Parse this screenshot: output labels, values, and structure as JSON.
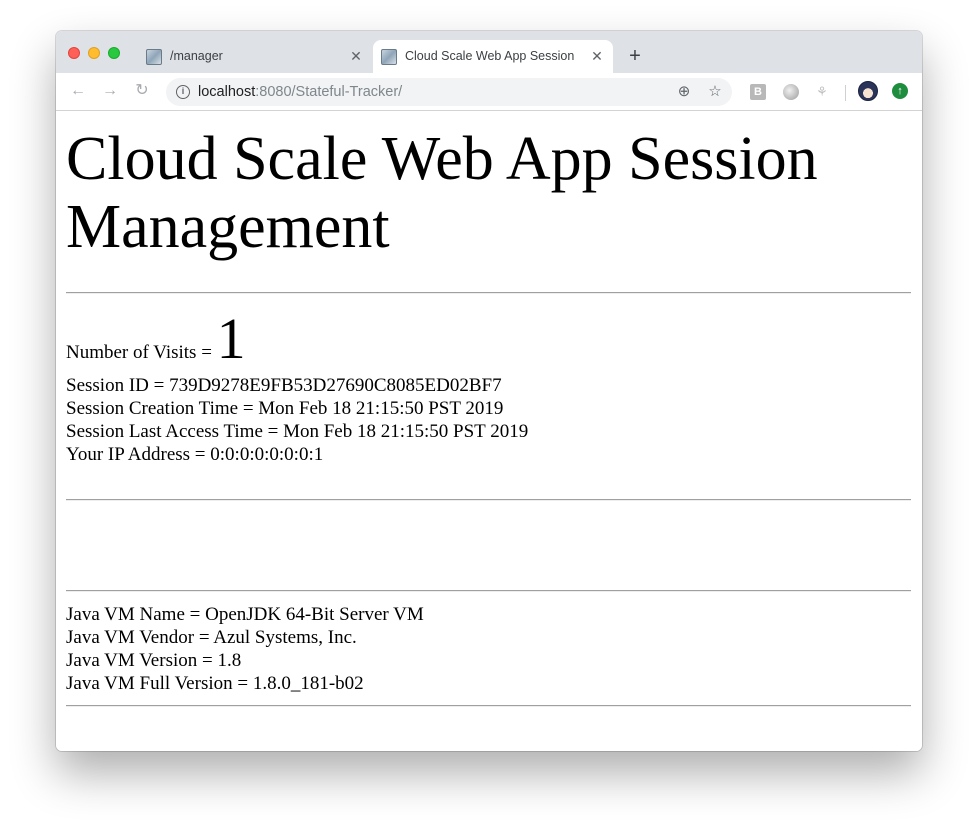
{
  "browser": {
    "tabs": [
      {
        "title": "/manager",
        "close": "✕",
        "active": false
      },
      {
        "title": "Cloud Scale Web App Session Management",
        "close": "✕",
        "active": true
      }
    ],
    "new_tab": "+",
    "url_host": "localhost",
    "url_rest": ":8080/Stateful-Tracker/",
    "nav": {
      "back": "←",
      "forward": "→",
      "reload": "↻"
    },
    "omnibox_icons": {
      "info": "i",
      "zoom": "⊕",
      "bookmark": "☆"
    },
    "extensions": {
      "b_label": "B",
      "update": "↑"
    }
  },
  "page": {
    "heading": "Cloud Scale Web App Session Management",
    "visits_label": "Number of Visits = ",
    "visits_count": "1",
    "session_id": "Session ID = 739D9278E9FB53D27690C8085ED02BF7",
    "creation_time": "Session Creation Time = Mon Feb 18 21:15:50 PST 2019",
    "last_access_time": "Session Last Access Time = Mon Feb 18 21:15:50 PST 2019",
    "ip_address": "Your IP Address = 0:0:0:0:0:0:0:1",
    "vm_name": "Java VM Name = OpenJDK 64-Bit Server VM",
    "vm_vendor": "Java VM Vendor = Azul Systems, Inc.",
    "vm_version": "Java VM Version = 1.8",
    "vm_full_version": "Java VM Full Version = 1.8.0_181-b02"
  }
}
